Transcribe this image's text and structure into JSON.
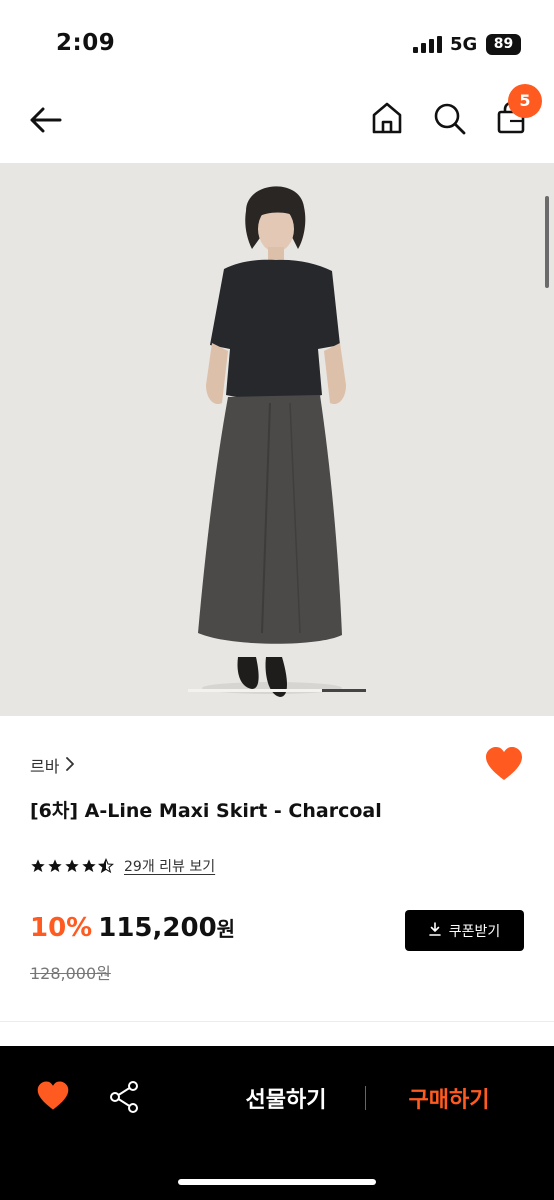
{
  "status_bar": {
    "time": "2:09",
    "network": "5G",
    "battery": "89"
  },
  "header": {
    "icons": [
      "back-arrow-icon",
      "home-icon",
      "search-icon",
      "shopping-bag-icon"
    ],
    "cart_count": "5"
  },
  "gallery": {
    "page_index": 4,
    "page_count": 4
  },
  "product": {
    "brand": "르바",
    "title": "[6차] A-Line Maxi Skirt - Charcoal",
    "rating": 4.5,
    "review_text": "29개 리뷰 보기",
    "discount": "10%",
    "price": "115,200",
    "price_unit": "원",
    "original_price": "128,000원",
    "coupon_label": "쿠폰받기",
    "wishlisted": true
  },
  "bottom_bar": {
    "gift_label": "선물하기",
    "buy_label": "구매하기"
  },
  "colors": {
    "accent": "#ff5a1f",
    "dark": "#000000",
    "background": "#ffffff"
  }
}
